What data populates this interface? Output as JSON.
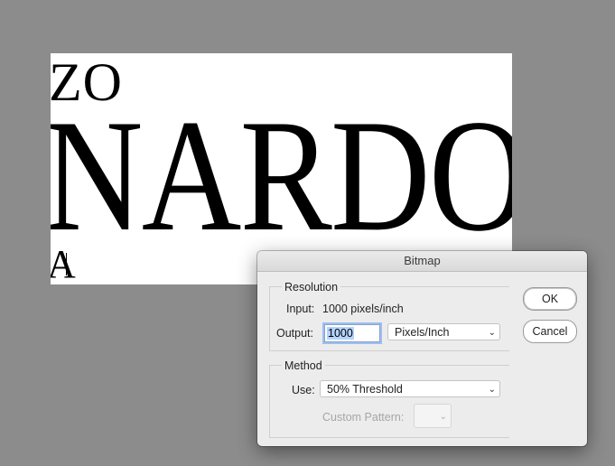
{
  "canvas": {
    "line_small": "ZO",
    "line_big": "NARDO",
    "line_bottom": "A"
  },
  "dialog": {
    "title": "Bitmap",
    "resolution": {
      "title": "Resolution",
      "input_label": "Input:",
      "input_value": "1000 pixels/inch",
      "output_label": "Output:",
      "output_value": "1000",
      "unit_selected": "Pixels/Inch"
    },
    "method": {
      "title": "Method",
      "use_label": "Use:",
      "use_selected": "50% Threshold",
      "custom_pattern_label": "Custom Pattern:"
    },
    "ok_label": "OK",
    "cancel_label": "Cancel"
  },
  "icons": {
    "dropdown": "chevron-down-icon"
  }
}
